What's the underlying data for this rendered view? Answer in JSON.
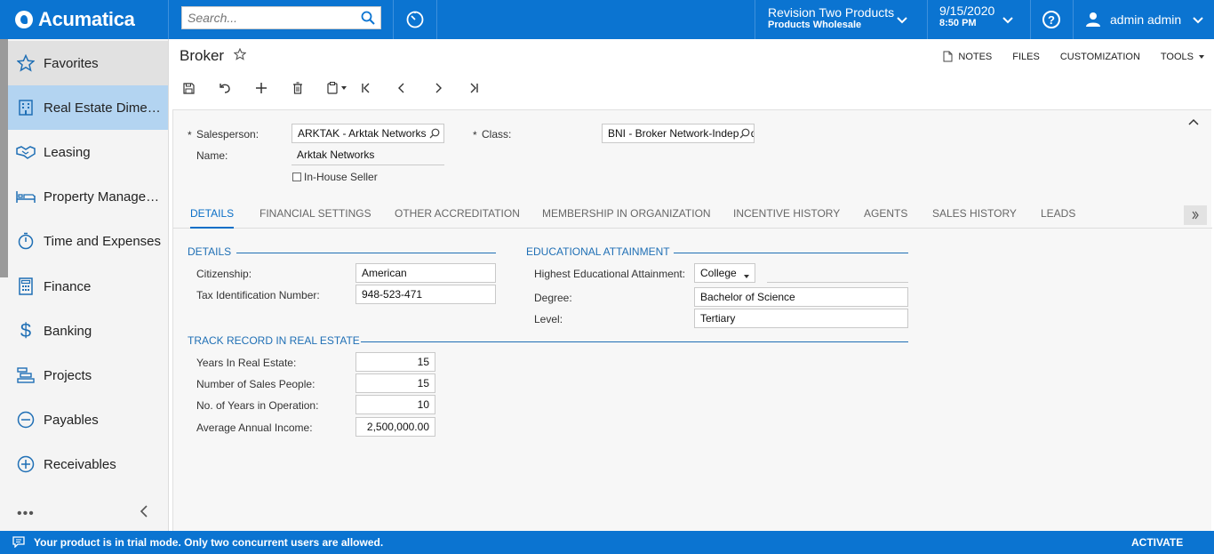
{
  "app": {
    "brand": "Acumatica",
    "search_placeholder": "Search...",
    "tenant_name": "Revision Two Products",
    "tenant_branch": "Products Wholesale",
    "date": "9/15/2020",
    "time": "8:50 PM",
    "user": "admin admin",
    "accent_color": "#0b74d1"
  },
  "sidebar": {
    "items": [
      {
        "label": "Favorites",
        "icon": "star-icon"
      },
      {
        "label": "Real Estate Dimensions",
        "icon": "building-icon"
      },
      {
        "label": "Leasing",
        "icon": "handshake-icon"
      },
      {
        "label": "Property Management",
        "icon": "bed-icon"
      },
      {
        "label": "Time and Expenses",
        "icon": "stopwatch-icon"
      },
      {
        "label": "Finance",
        "icon": "calculator-icon"
      },
      {
        "label": "Banking",
        "icon": "dollar-icon"
      },
      {
        "label": "Projects",
        "icon": "gantt-icon"
      },
      {
        "label": "Payables",
        "icon": "minus-circle-icon"
      },
      {
        "label": "Receivables",
        "icon": "plus-circle-icon"
      }
    ],
    "more": "•••"
  },
  "page": {
    "title": "Broker",
    "links": {
      "notes": "NOTES",
      "files": "FILES",
      "customization": "CUSTOMIZATION",
      "tools": "TOOLS"
    }
  },
  "form": {
    "salesperson_label": "Salesperson:",
    "salesperson_value": "ARKTAK - Arktak Networks",
    "class_label": "Class:",
    "class_value": "BNI - Broker Network-Independent",
    "name_label": "Name:",
    "name_value": "Arktak Networks",
    "inhouse_label": "In-House Seller",
    "required_mark": "*"
  },
  "tabs": [
    "DETAILS",
    "FINANCIAL SETTINGS",
    "OTHER ACCREDITATION",
    "MEMBERSHIP IN ORGANIZATION",
    "INCENTIVE HISTORY",
    "AGENTS",
    "SALES HISTORY",
    "LEADS"
  ],
  "details": {
    "header": "DETAILS",
    "citizenship_label": "Citizenship:",
    "citizenship_value": "American",
    "tin_label": "Tax Identification Number:",
    "tin_value": "948-523-471"
  },
  "education": {
    "header": "EDUCATIONAL ATTAINMENT",
    "highest_label": "Highest Educational Attainment:",
    "highest_value": "College",
    "degree_label": "Degree:",
    "degree_value": "Bachelor of Science",
    "level_label": "Level:",
    "level_value": "Tertiary"
  },
  "track_record": {
    "header": "TRACK RECORD IN REAL ESTATE",
    "years_label": "Years In Real Estate:",
    "years_value": "15",
    "sales_people_label": "Number of Sales People:",
    "sales_people_value": "15",
    "years_op_label": "No. of Years in Operation:",
    "years_op_value": "10",
    "income_label": "Average Annual Income:",
    "income_value": "2,500,000.00"
  },
  "footer": {
    "message": "Your product is in trial mode. Only two concurrent users are allowed.",
    "activate": "ACTIVATE"
  }
}
